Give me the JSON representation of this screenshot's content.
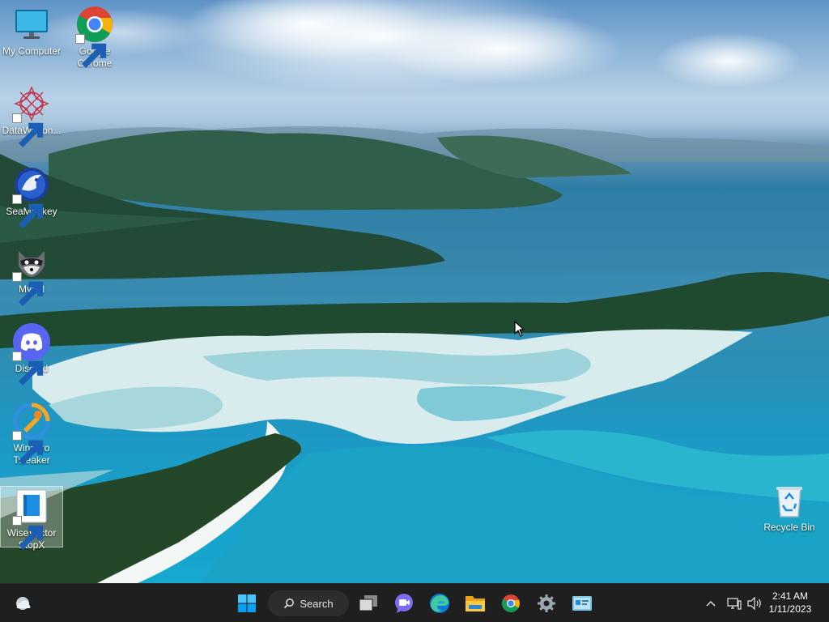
{
  "desktop": {
    "icons": [
      {
        "label": "My Computer",
        "icon": "monitor-icon"
      },
      {
        "label": "Google Chrome",
        "icon": "chrome-icon"
      },
      {
        "label": "DataWagon...",
        "icon": "datawagon-icon"
      },
      {
        "label": "SeaMonkey",
        "icon": "seamonkey-icon"
      },
      {
        "label": "Mypal",
        "icon": "mypal-icon"
      },
      {
        "label": "Discord",
        "icon": "discord-icon"
      },
      {
        "label": "Winaero Tweaker",
        "icon": "winaero-tweaker-icon"
      },
      {
        "label": "WiseVector StopX",
        "icon": "wisevector-icon"
      },
      {
        "label": "Recycle Bin",
        "icon": "recycle-bin-icon"
      }
    ]
  },
  "taskbar": {
    "search_label": "Search",
    "apps": [
      "start-icon",
      "task-view-icon",
      "chat-icon",
      "edge-icon",
      "file-explorer-icon",
      "chrome-icon",
      "settings-icon",
      "control-panel-icon"
    ],
    "clock": {
      "time": "2:41 AM",
      "date": "1/11/2023"
    }
  },
  "colors": {
    "taskbar": "#1f1f1f",
    "accent": "#0078d4"
  }
}
